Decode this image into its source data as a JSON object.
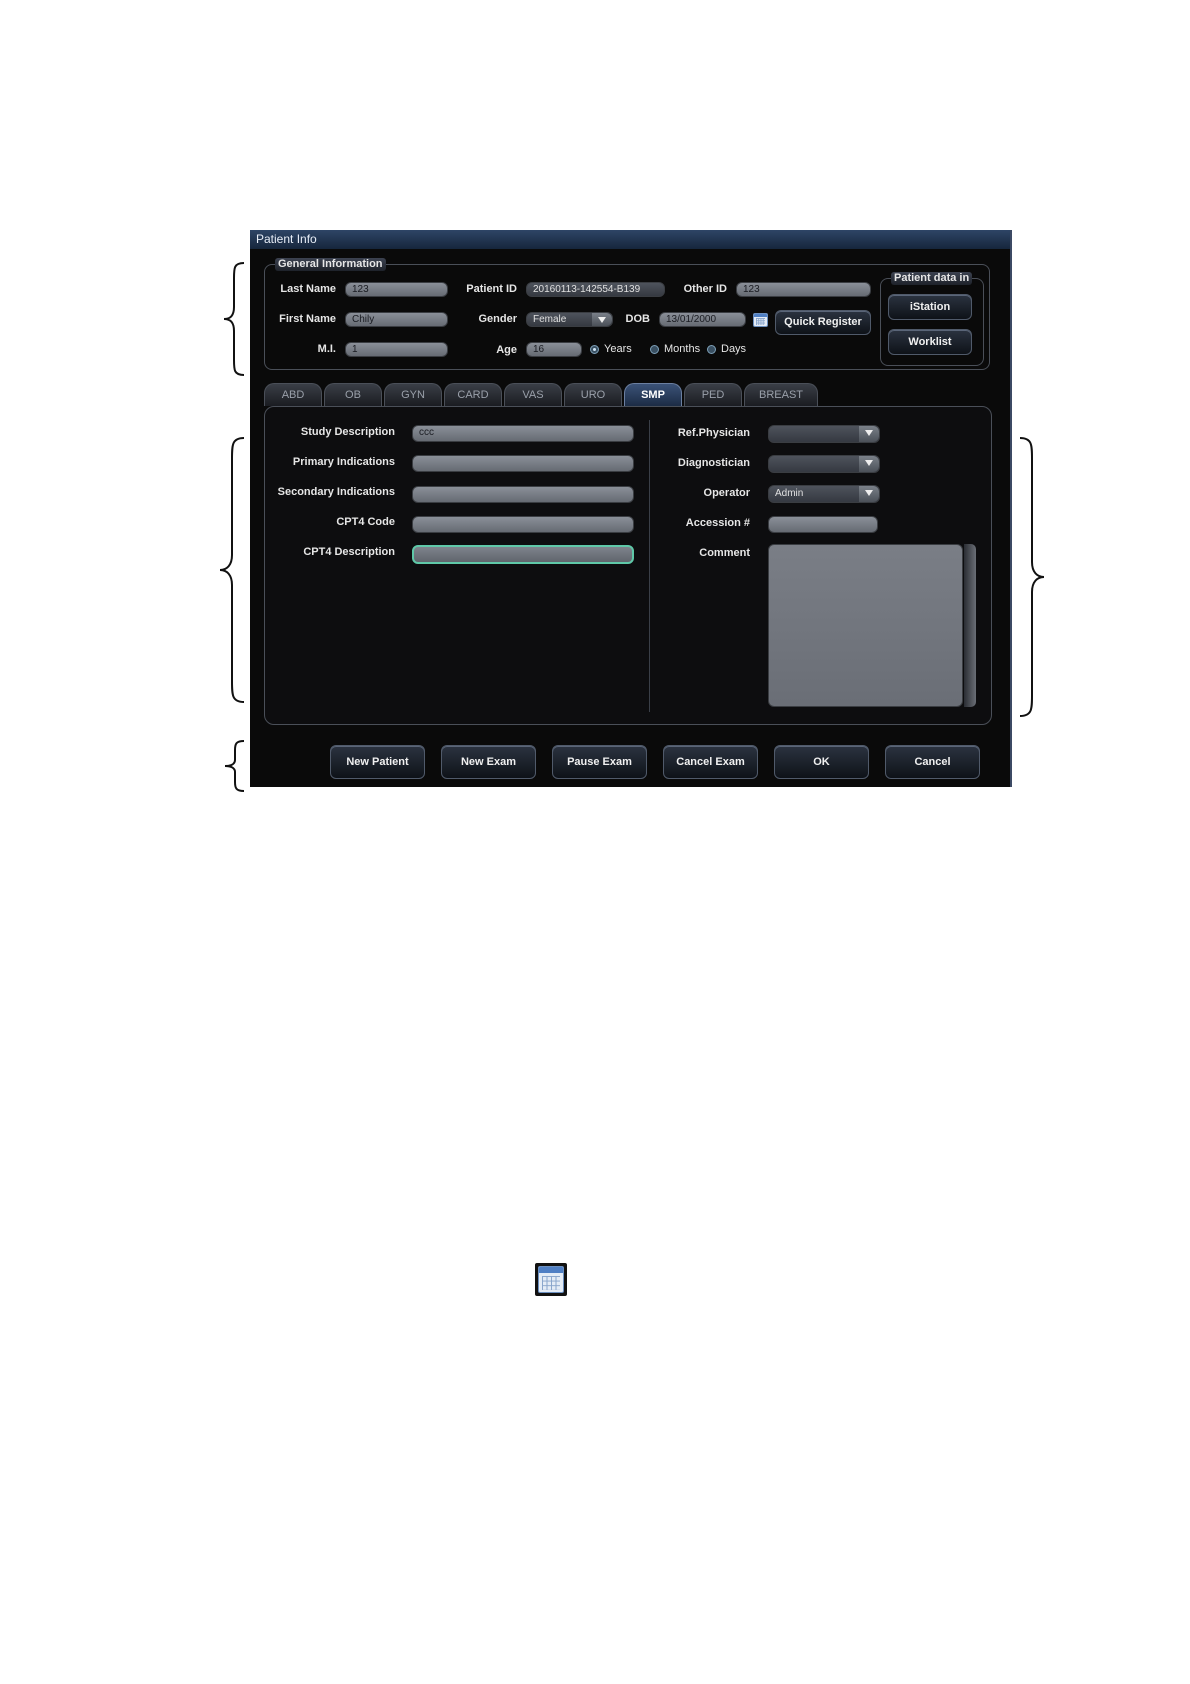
{
  "window": {
    "title": "Patient Info"
  },
  "general": {
    "title": "General Information",
    "last_name_label": "Last Name",
    "last_name": "123",
    "first_name_label": "First Name",
    "first_name": "Chily",
    "mi_label": "M.I.",
    "mi": "1",
    "patient_id_label": "Patient ID",
    "patient_id": "20160113-142554-B139",
    "gender_label": "Gender",
    "gender": "Female",
    "dob_label": "DOB",
    "dob": "13/01/2000",
    "age_label": "Age",
    "age": "16",
    "other_id_label": "Other ID",
    "other_id": "123",
    "age_units": [
      "Years",
      "Months",
      "Days"
    ],
    "age_unit_selected": "Years",
    "quick_register": "Quick Register"
  },
  "patient_data_in": {
    "title": "Patient data in",
    "istation": "iStation",
    "worklist": "Worklist"
  },
  "tabs": [
    "ABD",
    "OB",
    "GYN",
    "CARD",
    "VAS",
    "URO",
    "SMP",
    "PED",
    "BREAST"
  ],
  "active_tab": "SMP",
  "study": {
    "study_description_label": "Study Description",
    "study_description": "ccc",
    "primary_indications_label": "Primary Indications",
    "primary_indications": "",
    "secondary_indications_label": "Secondary Indications",
    "secondary_indications": "",
    "cpt4_code_label": "CPT4 Code",
    "cpt4_code": "",
    "cpt4_description_label": "CPT4 Description",
    "cpt4_description": "",
    "ref_physician_label": "Ref.Physician",
    "ref_physician": "",
    "diagnostician_label": "Diagnostician",
    "diagnostician": "",
    "operator_label": "Operator",
    "operator": "Admin",
    "accession_label": "Accession #",
    "accession": "",
    "comment_label": "Comment",
    "comment": ""
  },
  "buttons": {
    "new_patient": "New Patient",
    "new_exam": "New Exam",
    "pause_exam": "Pause Exam",
    "cancel_exam": "Cancel Exam",
    "ok": "OK",
    "cancel": "Cancel"
  }
}
